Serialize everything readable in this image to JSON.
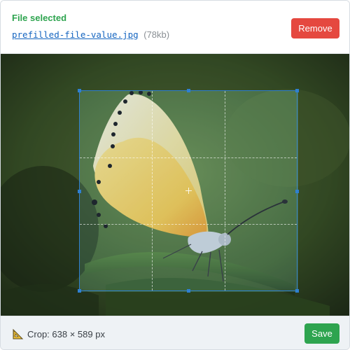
{
  "header": {
    "status": "File selected",
    "filename": "prefilled-file-value.jpg",
    "filesize": "(78kb)",
    "remove_label": "Remove"
  },
  "footer": {
    "crop_label": "Crop: 638 × 589 px",
    "save_label": "Save"
  },
  "image": {
    "subject_icon": "butterfly-photo"
  },
  "colors": {
    "success": "#2ea44f",
    "danger": "#e5483f",
    "link": "#1565c0",
    "crop_accent": "#2f80d1"
  }
}
